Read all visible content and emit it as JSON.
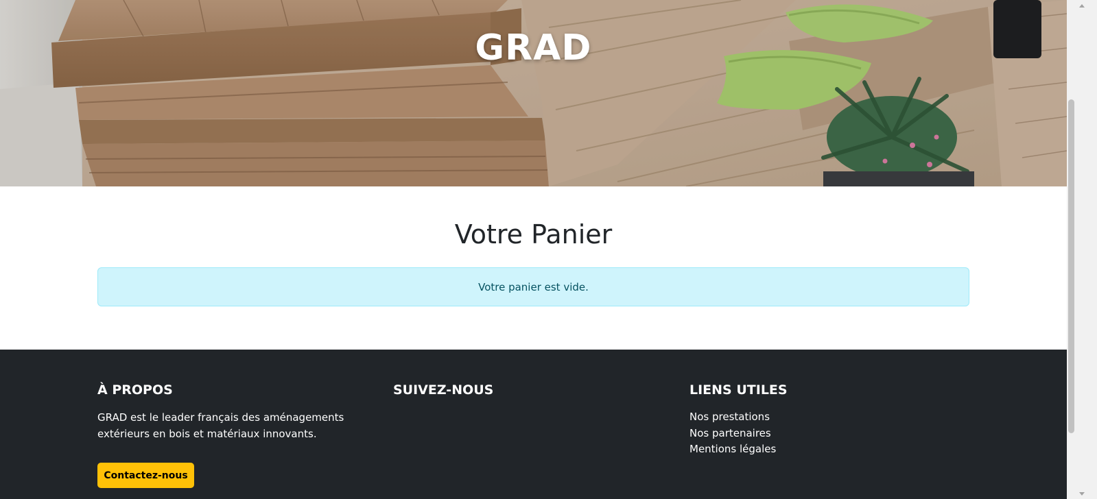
{
  "hero": {
    "brand": "GRAD",
    "image_description_icon": "wooden-deck-photo"
  },
  "main": {
    "title": "Votre Panier",
    "alert_message": "Votre panier est vide."
  },
  "footer": {
    "about": {
      "heading": "À PROPOS",
      "text": "GRAD est le leader français des aménagements extérieurs en bois et matériaux innovants.",
      "button_label": "Contactez-nous"
    },
    "follow": {
      "heading": "SUIVEZ-NOUS"
    },
    "links": {
      "heading": "LIENS UTILES",
      "items": [
        {
          "label": "Nos prestations"
        },
        {
          "label": "Nos partenaires"
        },
        {
          "label": "Mentions légales"
        }
      ]
    }
  },
  "colors": {
    "footer_bg": "#212529",
    "alert_bg": "#cff4fc",
    "alert_border": "#9eeaf9",
    "alert_text": "#055160",
    "button_bg": "#ffc107",
    "title_text": "#212529"
  }
}
